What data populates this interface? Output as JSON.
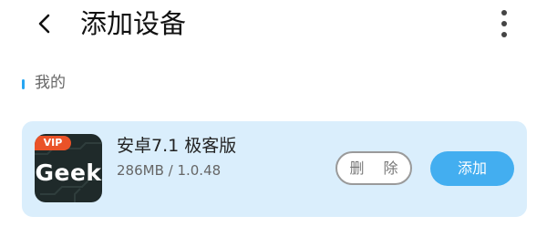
{
  "header": {
    "title": "添加设备",
    "back_icon": "chevron-left-icon",
    "more_icon": "more-vertical-icon"
  },
  "section": {
    "label": "我的",
    "accent_color": "#27a6f2"
  },
  "device": {
    "badge": "VIP",
    "icon_text": "Geek",
    "name": "安卓7.1 极客版",
    "meta": "286MB / 1.0.48",
    "delete_label": "删 除",
    "add_label": "添加",
    "card_color": "#daeefc",
    "add_color": "#43aef0",
    "badge_color": "#ea5228"
  }
}
